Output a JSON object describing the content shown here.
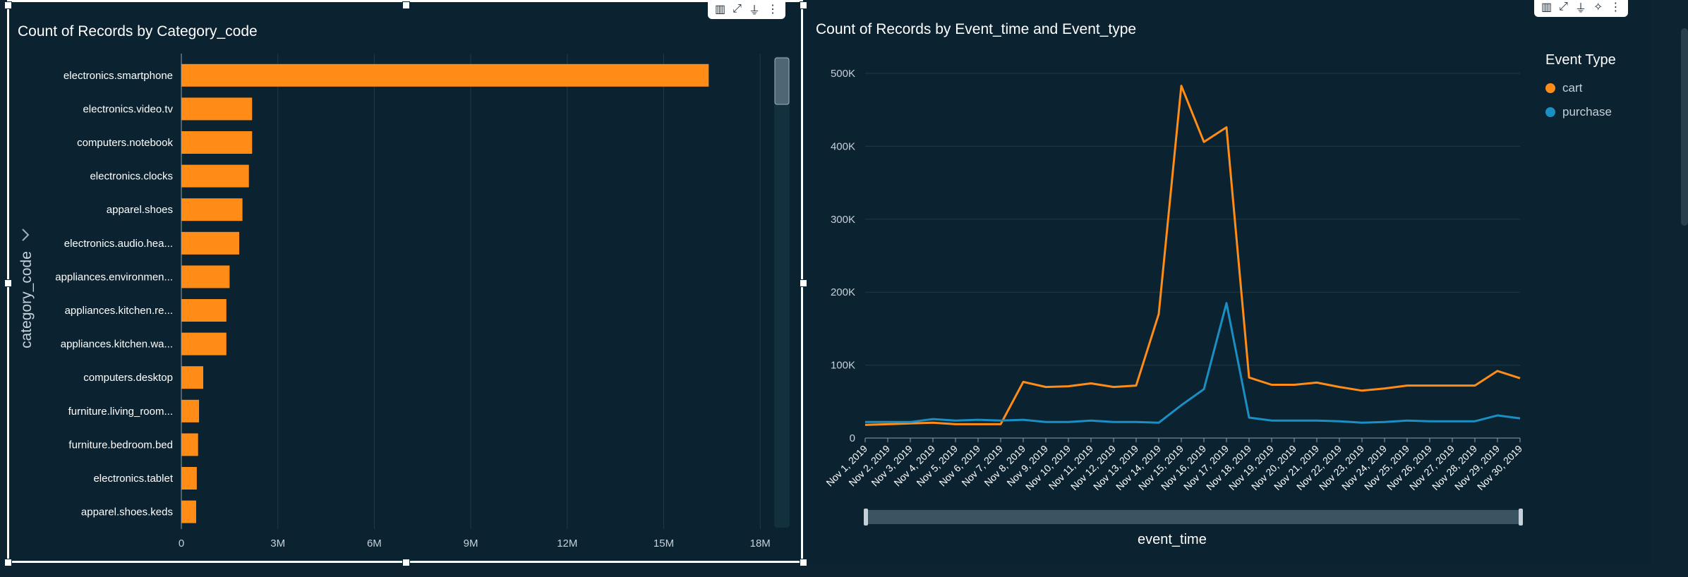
{
  "left_chart": {
    "toolbar_icons": [
      "chart-type-icon",
      "expand-icon",
      "filter-icon",
      "more-icon"
    ],
    "chart_data": {
      "type": "bar",
      "orientation": "horizontal",
      "title": "Count of Records by Category_code",
      "ylabel": "category_code",
      "xlabel": "",
      "categories": [
        "electronics.smartphone",
        "electronics.video.tv",
        "computers.notebook",
        "electronics.clocks",
        "apparel.shoes",
        "electronics.audio.hea...",
        "appliances.environmen...",
        "appliances.kitchen.re...",
        "appliances.kitchen.wa...",
        "computers.desktop",
        "furniture.living_room...",
        "furniture.bedroom.bed",
        "electronics.tablet",
        "apparel.shoes.keds"
      ],
      "values": [
        16400000,
        2200000,
        2200000,
        2100000,
        1900000,
        1800000,
        1500000,
        1400000,
        1400000,
        680000,
        550000,
        520000,
        480000,
        460000
      ],
      "xlim": [
        0,
        18500000
      ],
      "ticks": [
        0,
        3000000,
        6000000,
        9000000,
        12000000,
        15000000,
        18000000
      ],
      "tick_labels": [
        "0",
        "3M",
        "6M",
        "9M",
        "12M",
        "15M",
        "18M"
      ],
      "grid": true,
      "bar_color": "#ff8c17"
    }
  },
  "right_chart": {
    "toolbar_icons": [
      "chart-type-icon",
      "expand-icon",
      "filter-icon",
      "insight-icon",
      "more-icon"
    ],
    "chart_data": {
      "type": "line",
      "title": "Count of Records by Event_time and Event_type",
      "xlabel": "event_time",
      "ylabel": "",
      "x": [
        "Nov 1, 2019",
        "Nov 2, 2019",
        "Nov 3, 2019",
        "Nov 4, 2019",
        "Nov 5, 2019",
        "Nov 6, 2019",
        "Nov 7, 2019",
        "Nov 8, 2019",
        "Nov 9, 2019",
        "Nov 10, 2019",
        "Nov 11, 2019",
        "Nov 12, 2019",
        "Nov 13, 2019",
        "Nov 14, 2019",
        "Nov 15, 2019",
        "Nov 16, 2019",
        "Nov 17, 2019",
        "Nov 18, 2019",
        "Nov 19, 2019",
        "Nov 20, 2019",
        "Nov 21, 2019",
        "Nov 22, 2019",
        "Nov 23, 2019",
        "Nov 24, 2019",
        "Nov 25, 2019",
        "Nov 26, 2019",
        "Nov 27, 2019",
        "Nov 28, 2019",
        "Nov 29, 2019",
        "Nov 30, 2019"
      ],
      "series": [
        {
          "name": "cart",
          "color": "#ff8c17",
          "values": [
            18000,
            19000,
            20000,
            21000,
            19000,
            19000,
            19000,
            77000,
            70000,
            71000,
            75000,
            70000,
            72000,
            170000,
            483000,
            406000,
            426000,
            83000,
            73000,
            73000,
            76000,
            70000,
            65000,
            68000,
            72000,
            72000,
            72000,
            72000,
            92000,
            82000
          ]
        },
        {
          "name": "purchase",
          "color": "#1a8fc4",
          "values": [
            22000,
            22000,
            22000,
            26000,
            24000,
            25000,
            24000,
            25000,
            22000,
            22000,
            24000,
            22000,
            22000,
            21000,
            45000,
            67000,
            185000,
            28000,
            24000,
            24000,
            24000,
            23000,
            21000,
            22000,
            24000,
            23000,
            23000,
            23000,
            31000,
            27000
          ]
        }
      ],
      "ylim": [
        0,
        500000
      ],
      "ticks": [
        0,
        100000,
        200000,
        300000,
        400000,
        500000
      ],
      "tick_labels": [
        "0",
        "100K",
        "200K",
        "300K",
        "400K",
        "500K"
      ],
      "grid": true,
      "legend": {
        "title": "Event Type",
        "placement": "right"
      }
    }
  }
}
